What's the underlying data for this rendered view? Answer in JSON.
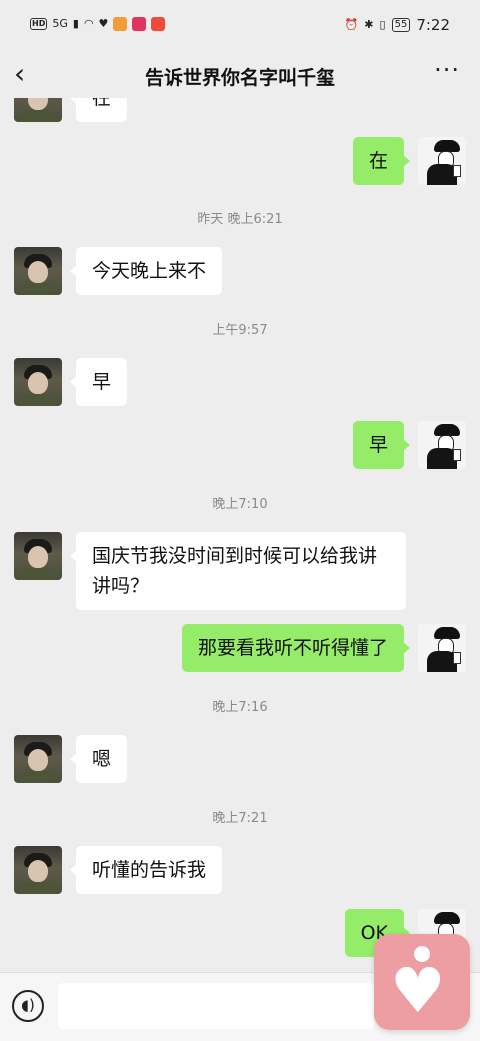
{
  "status_bar": {
    "left_labels": [
      "HD",
      "5G"
    ],
    "battery": "55",
    "time": "7:22"
  },
  "header": {
    "back_glyph": "‹",
    "title": "告诉世界你名字叫千玺",
    "more_glyph": "···"
  },
  "messages": [
    {
      "side": "left",
      "text": "在"
    },
    {
      "side": "right",
      "text": "在"
    },
    {
      "type": "timestamp",
      "text": "昨天 晚上6:21"
    },
    {
      "side": "left",
      "text": "今天晚上来不"
    },
    {
      "type": "timestamp",
      "text": "上午9:57"
    },
    {
      "side": "left",
      "text": "早"
    },
    {
      "side": "right",
      "text": "早"
    },
    {
      "type": "timestamp",
      "text": "晚上7:10"
    },
    {
      "side": "left",
      "text": "国庆节我没时间到时候可以给我讲讲吗？"
    },
    {
      "side": "right",
      "text": "那要看我听不听得懂了"
    },
    {
      "type": "timestamp",
      "text": "晚上7:16"
    },
    {
      "side": "left",
      "text": "嗯"
    },
    {
      "type": "timestamp",
      "text": "晚上7:21"
    },
    {
      "side": "left",
      "text": "听懂的告诉我"
    },
    {
      "side": "right",
      "text": "OK"
    }
  ],
  "input_bar": {
    "voice_glyph": "◖)",
    "placeholder": ""
  },
  "icons": {
    "back": "chevron-left-icon",
    "more": "more-dots-icon",
    "voice": "voice-icon",
    "floating": "heart-app-icon"
  },
  "colors": {
    "background": "#ededed",
    "outgoing_bubble": "#95ec69",
    "incoming_bubble": "#ffffff",
    "floating_badge": "#ec9ea3"
  }
}
